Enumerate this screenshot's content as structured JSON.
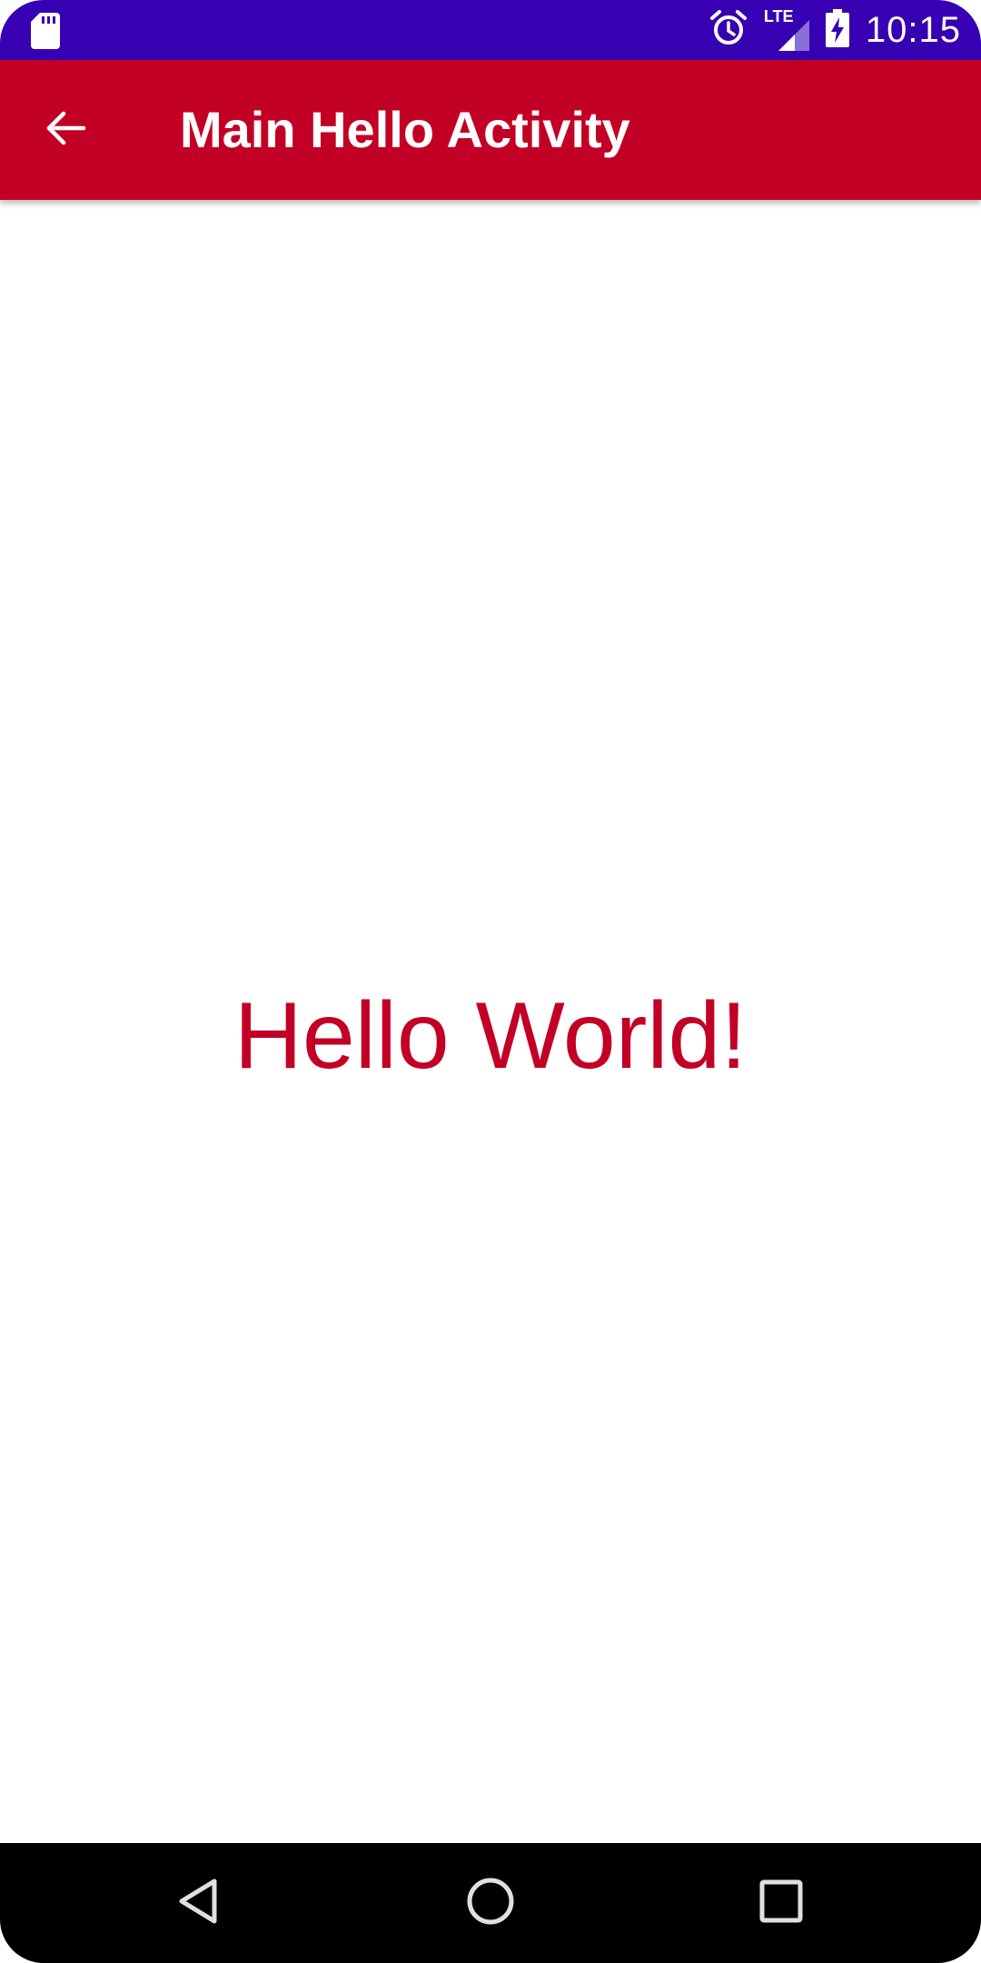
{
  "status_bar": {
    "time": "10:15",
    "network_label": "LTE",
    "background_color": "#3700b3",
    "icons": [
      "sd-card-icon",
      "alarm-icon",
      "lte-signal-icon",
      "battery-charging-icon"
    ]
  },
  "app_bar": {
    "title": "Main Hello Activity",
    "background_color": "#c20025",
    "back_icon": "arrow-back-icon"
  },
  "content": {
    "message": "Hello World!",
    "text_color": "#c20025"
  },
  "nav_bar": {
    "buttons": [
      "nav-back-icon",
      "nav-home-icon",
      "nav-recents-icon"
    ]
  }
}
